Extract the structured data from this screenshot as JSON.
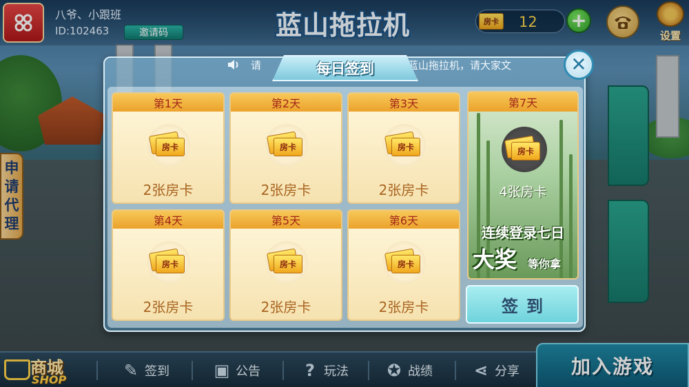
{
  "header": {
    "user_name": "八爷、小跟班",
    "user_id": "ID:102463",
    "invite_label": "邀请码",
    "game_title": "蓝山拖拉机",
    "card_icon_text": "房卡",
    "card_count": "12",
    "add_label": "+",
    "settings_label": "设置"
  },
  "side": {
    "agent_chars": [
      "申",
      "请",
      "代",
      "理"
    ]
  },
  "marquee": {
    "left_text": "请",
    "right_text": "蓝山拖拉机，请大家文"
  },
  "dialog": {
    "title": "每日签到",
    "close_label": "✕",
    "coupon_text": "房卡",
    "days": [
      {
        "label": "第1天",
        "reward": "2张房卡"
      },
      {
        "label": "第2天",
        "reward": "2张房卡"
      },
      {
        "label": "第3天",
        "reward": "2张房卡"
      },
      {
        "label": "第4天",
        "reward": "2张房卡"
      },
      {
        "label": "第5天",
        "reward": "2张房卡"
      },
      {
        "label": "第6天",
        "reward": "2张房卡"
      }
    ],
    "day7": {
      "label": "第7天",
      "reward": "4张房卡",
      "promo_line1": "连续登录七日",
      "promo_big": "大奖",
      "promo_small": "等你拿"
    },
    "signin_label": "签到"
  },
  "bottom": {
    "shop_main": "商城",
    "shop_sub": "SHOP",
    "signin": "签到",
    "notice": "公告",
    "rules": "玩法",
    "record": "战绩",
    "share": "分享",
    "join_game": "加入游戏"
  },
  "colors": {
    "accent_teal": "#29b3a6",
    "day_header": "#f7c858",
    "reward_text": "#a86420",
    "coupon": "#ffd84a"
  }
}
